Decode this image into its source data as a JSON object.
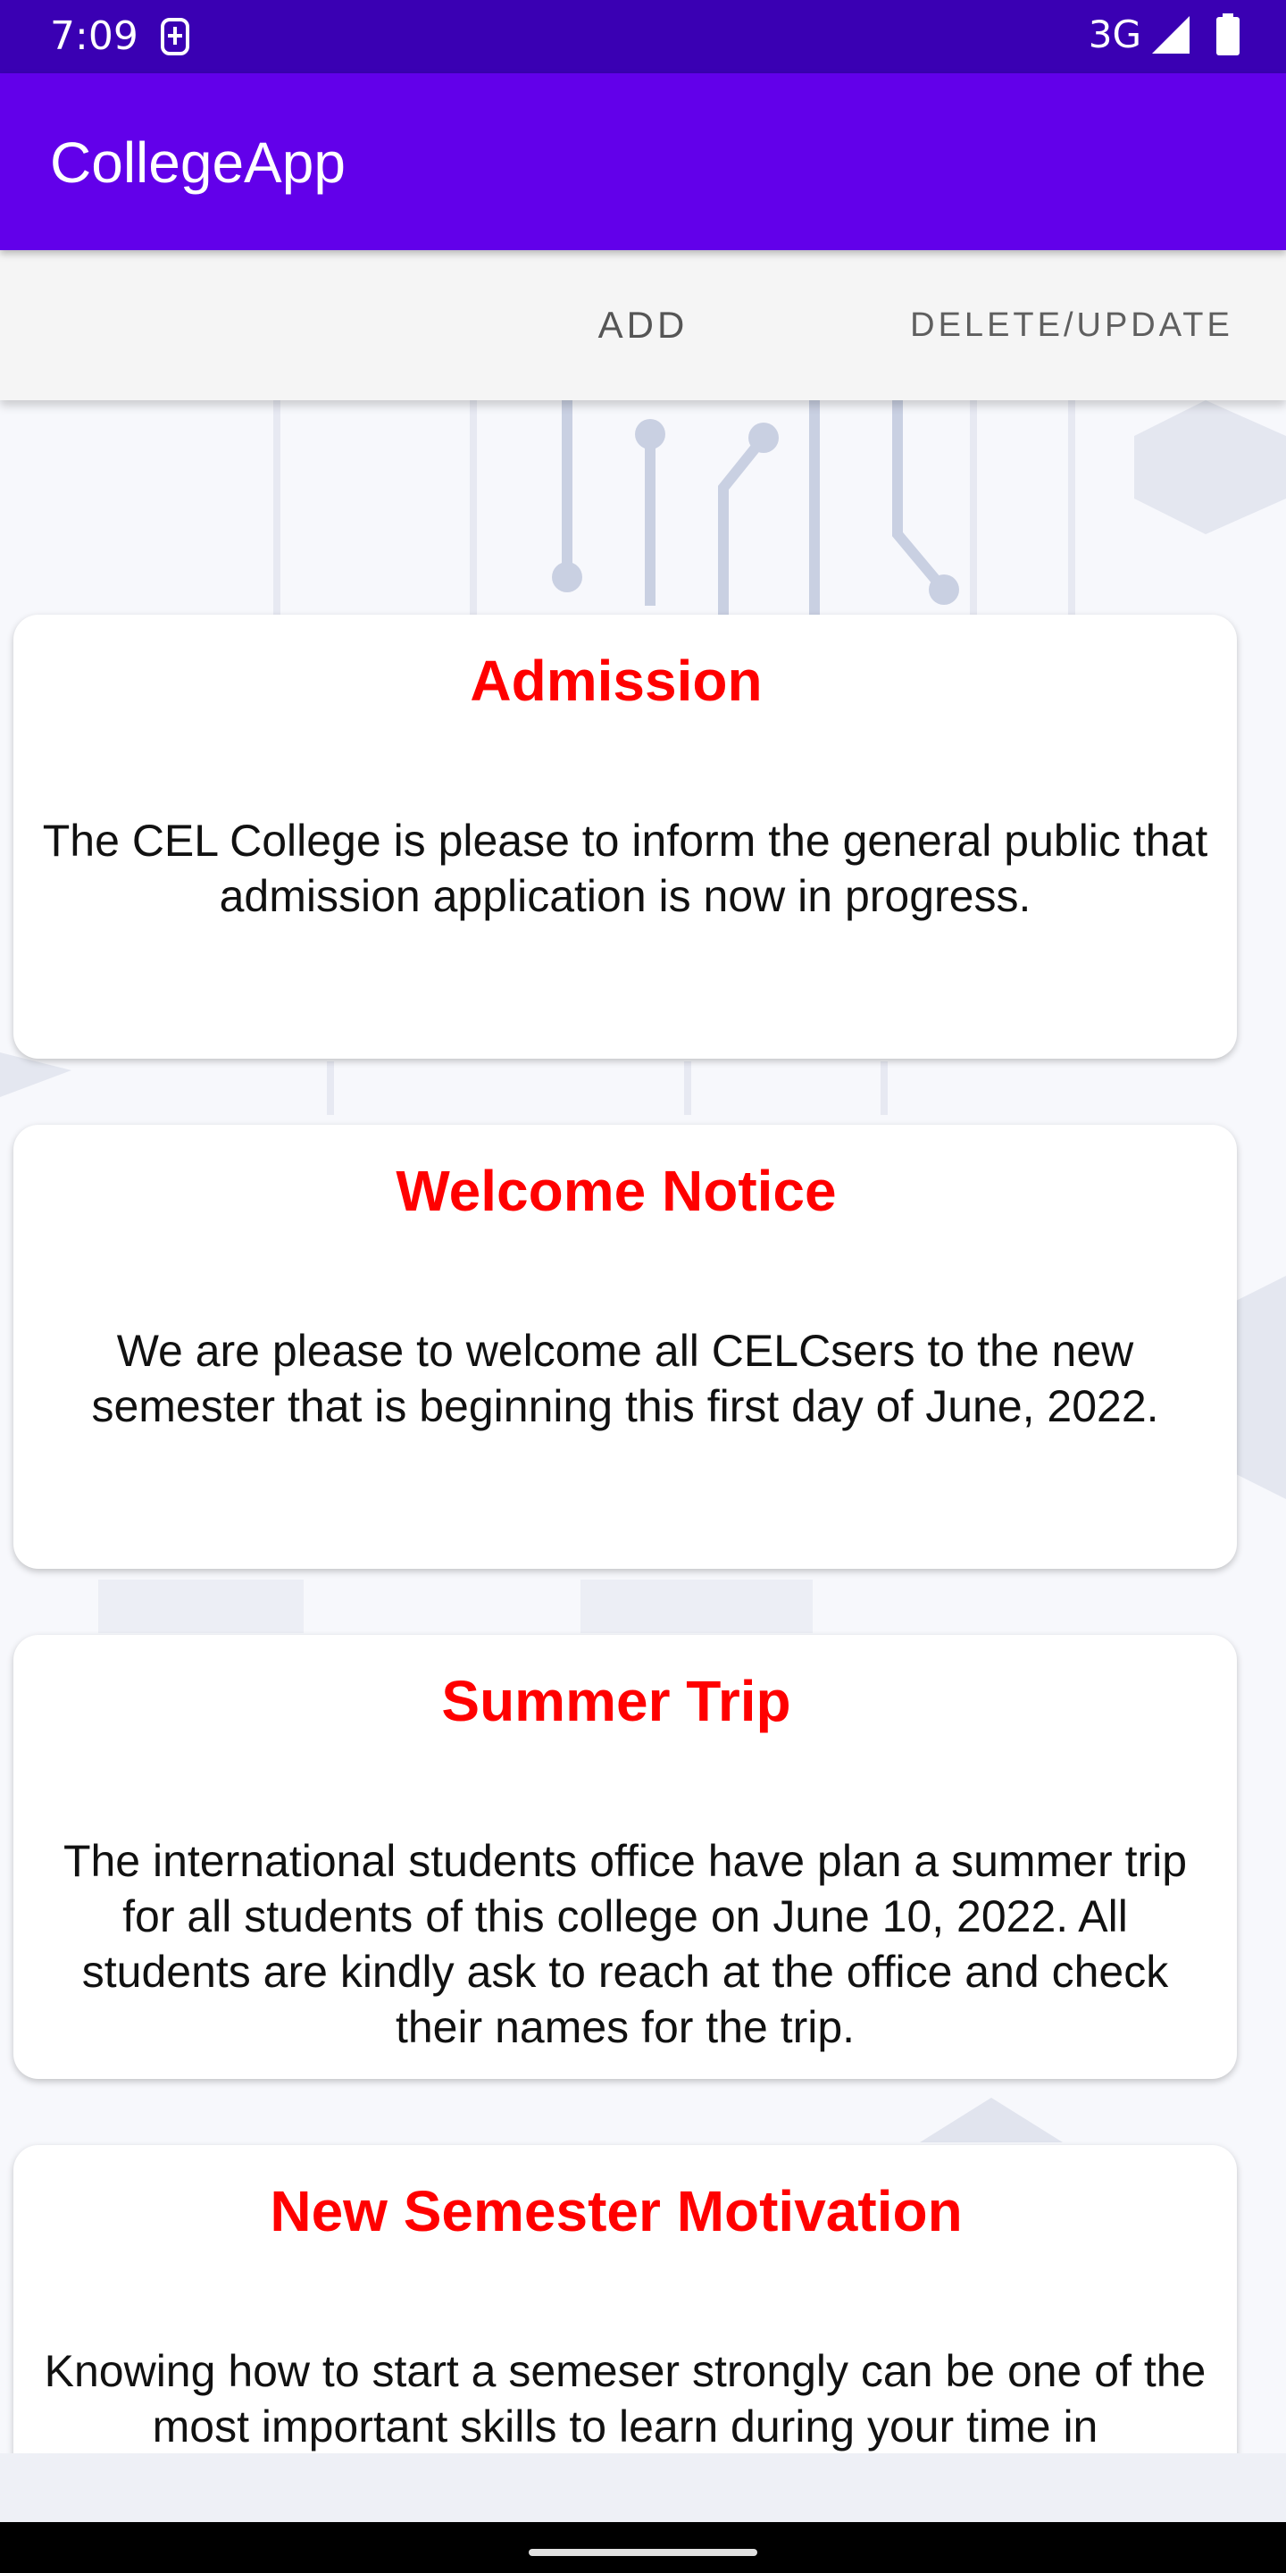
{
  "status_bar": {
    "time": "7:09",
    "network": "3G",
    "sim_icon": "sim-card-icon",
    "signal_icon": "signal-icon",
    "battery_icon": "battery-icon"
  },
  "app_bar": {
    "title": "CollegeApp"
  },
  "tabs": {
    "add_label": "ADD",
    "delete_update_label": "DELETE/UPDATE"
  },
  "notices": [
    {
      "title": "Admission",
      "body": "The CEL College is please to inform the general public that admission application is now in progress."
    },
    {
      "title": "Welcome Notice",
      "body": "We are please to welcome all CELCsers to the new semester that is beginning this first day of June, 2022."
    },
    {
      "title": "Summer Trip",
      "body": "The international students office have plan a summer trip for all students of this college on June 10, 2022. All students are kindly ask to reach at the office and check their names for the trip."
    },
    {
      "title": "New Semester Motivation",
      "body": "Knowing how to start a semeser strongly can be one of the most important skills to learn during your time in"
    }
  ],
  "colors": {
    "status_bar": "#3a00b3",
    "app_bar": "#6200ea",
    "notice_title": "#ff0000",
    "tab_bar": "#f5f5f5"
  }
}
